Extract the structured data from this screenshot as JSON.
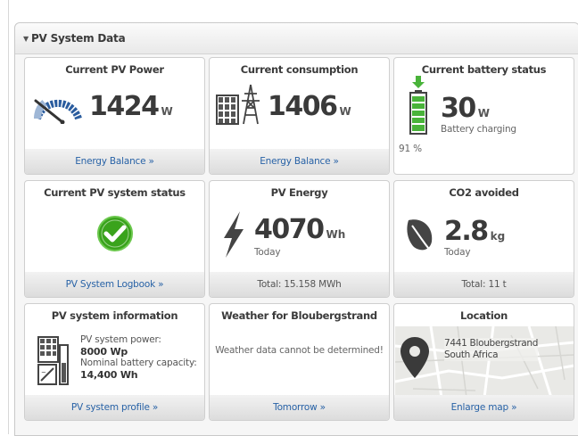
{
  "panel": {
    "title": "PV System Data"
  },
  "tiles": {
    "pv_power": {
      "title": "Current PV Power",
      "value": "1424",
      "unit": "W",
      "link": "Energy Balance »"
    },
    "consumption": {
      "title": "Current consumption",
      "value": "1406",
      "unit": "W",
      "link": "Energy Balance »"
    },
    "battery": {
      "title": "Current battery status",
      "value": "30",
      "unit": "W",
      "status": "Battery charging",
      "percent": "91 %",
      "charge_level": 0.91
    },
    "system_status": {
      "title": "Current PV system status",
      "link": "PV System Logbook »"
    },
    "pv_energy": {
      "title": "PV Energy",
      "value": "4070",
      "unit": "Wh",
      "period": "Today",
      "total": "Total: 15.158 MWh"
    },
    "co2": {
      "title": "CO2 avoided",
      "value": "2.8",
      "unit": "kg",
      "period": "Today",
      "total": "Total: 11 t"
    },
    "info": {
      "title": "PV system information",
      "power_label": "PV system power:",
      "power_value": "8000 Wp",
      "battery_label": "Nominal battery capacity:",
      "battery_value": "14,400 Wh",
      "link": "PV system profile »"
    },
    "weather": {
      "title": "Weather for Bloubergstrand",
      "message": "Weather data cannot be determined!",
      "link": "Tomorrow »"
    },
    "location": {
      "title": "Location",
      "address_line1": "7441 Bloubergstrand",
      "address_line2": "South Africa",
      "link": "Enlarge map »"
    }
  },
  "colors": {
    "link": "#2862a6",
    "ok_green": "#3aa31c",
    "battery_green": "#49b33a",
    "gauge_blue": "#2a5c9e"
  }
}
